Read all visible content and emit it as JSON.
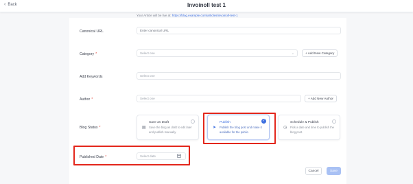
{
  "header": {
    "back_label": "Back",
    "title": "Invoinoll test 1"
  },
  "url_line": {
    "prefix": "Your Article will be live at:",
    "link": "https://blog.example.com/articles/invoinoll-test-1"
  },
  "form": {
    "canonical_url": {
      "label": "Canonical URL",
      "value": "Enter canonical URL"
    },
    "category": {
      "label": "Category",
      "required": "*",
      "placeholder": "Select one",
      "add_button": "+ Add New Category"
    },
    "add_keywords": {
      "label": "Add Keywords",
      "placeholder": "Select one"
    },
    "author": {
      "label": "Author",
      "required": "*",
      "placeholder": "Select one",
      "add_button": "+ Add New Author"
    },
    "blog_status": {
      "label": "Blog Status",
      "required": "*",
      "options": [
        {
          "title": "Save as Draft",
          "description": "Save the blog as draft to edit later and publish manually.",
          "icon": "document-icon",
          "selected": false
        },
        {
          "title": "Publish",
          "description": "Publish the blog post and make it available for the public.",
          "icon": "send-icon",
          "selected": true
        },
        {
          "title": "Schedule & Publish",
          "description": "Pick a date and time to publish the blog post.",
          "icon": "clock-icon",
          "selected": false
        }
      ]
    },
    "published_date": {
      "label": "Published Date",
      "required": "*",
      "placeholder": "Select date"
    }
  },
  "actions": {
    "cancel": "Cancel",
    "save": "Save"
  },
  "colors": {
    "accent": "#3d6fe0",
    "highlight": "#e3261b",
    "required": "#e0453a",
    "save_disabled": "#a9c1f4"
  }
}
